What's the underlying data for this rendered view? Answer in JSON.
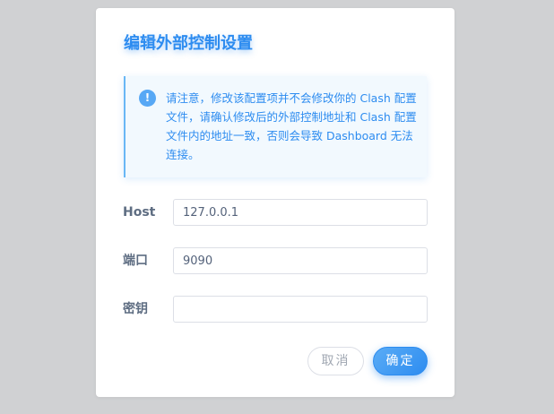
{
  "dialog": {
    "title": "编辑外部控制设置"
  },
  "alert": {
    "icon": "info-icon",
    "icon_glyph": "!",
    "message": "请注意，修改该配置项并不会修改你的 Clash 配置文件，请确认修改后的外部控制地址和 Clash 配置文件内的地址一致，否则会导致 Dashboard 无法连接。"
  },
  "form": {
    "host_label": "Host",
    "host_value": "127.0.0.1",
    "port_label": "端口",
    "port_value": "9090",
    "secret_label": "密钥",
    "secret_value": ""
  },
  "buttons": {
    "cancel": "取消",
    "confirm": "确定"
  },
  "colors": {
    "accent": "#2d8cf0",
    "overlay": "#d0d1d3",
    "label": "#5e6d82"
  }
}
